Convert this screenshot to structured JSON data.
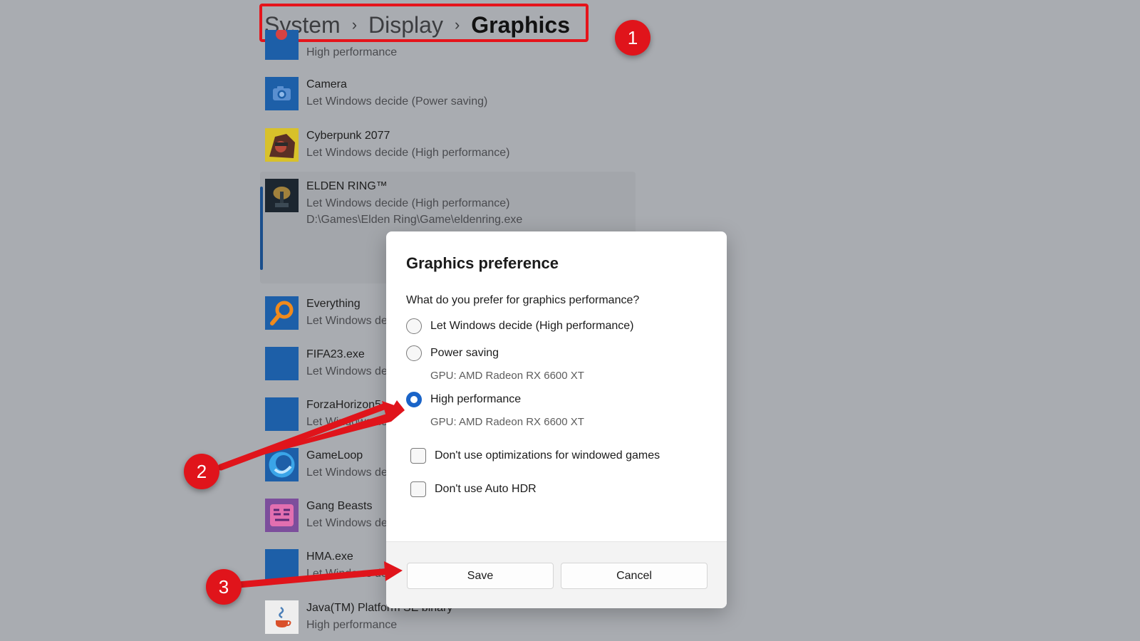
{
  "breadcrumb": {
    "items": [
      "System",
      "Display"
    ],
    "separator": "›",
    "current": "Graphics"
  },
  "apps": [
    {
      "name": "",
      "status": "High performance",
      "icon": "app-icon"
    },
    {
      "name": "Camera",
      "status": "Let Windows decide (Power saving)",
      "icon": "camera-icon"
    },
    {
      "name": "Cyberpunk 2077",
      "status": "Let Windows decide (High performance)",
      "icon": "cyberpunk-icon"
    },
    {
      "name": "ELDEN RING™",
      "status": "Let Windows decide (High performance)",
      "path": "D:\\Games\\Elden Ring\\Game\\eldenring.exe",
      "icon": "elden-ring-icon",
      "selected": true
    },
    {
      "name": "Everything",
      "status": "Let Windows de",
      "icon": "magnifier-icon"
    },
    {
      "name": "FIFA23.exe",
      "status": "Let Windows de",
      "icon": "blank-app-icon"
    },
    {
      "name": "ForzaHorizon5",
      "status": "Let Windows de",
      "icon": "blank-app-icon"
    },
    {
      "name": "GameLoop",
      "status": "Let Windows de",
      "icon": "gameloop-icon"
    },
    {
      "name": "Gang Beasts",
      "status": "Let Windows de",
      "icon": "gang-beasts-icon"
    },
    {
      "name": "HMA.exe",
      "status": "Let Windows de",
      "icon": "blank-app-icon"
    },
    {
      "name": "Java(TM) Platform SE binary",
      "status": "High performance",
      "icon": "java-icon"
    }
  ],
  "dialog": {
    "title": "Graphics preference",
    "question": "What do you prefer for graphics performance?",
    "options": [
      {
        "label": "Let Windows decide (High performance)",
        "selected": false
      },
      {
        "label": "Power saving",
        "sub": "GPU: AMD Radeon RX 6600 XT",
        "selected": false
      },
      {
        "label": "High performance",
        "sub": "GPU: AMD Radeon RX 6600 XT",
        "selected": true
      }
    ],
    "checkboxes": [
      {
        "label": "Don't use optimizations for windowed games",
        "checked": false
      },
      {
        "label": "Don't use Auto HDR",
        "checked": false
      }
    ],
    "save_label": "Save",
    "cancel_label": "Cancel"
  },
  "annotations": {
    "badges": [
      "1",
      "2",
      "3"
    ],
    "color": "#e0141b"
  },
  "colors": {
    "accent": "#1a64c8",
    "app_icon_bg": "#1d5fa8",
    "overlay_bg": "#a9acb1"
  }
}
